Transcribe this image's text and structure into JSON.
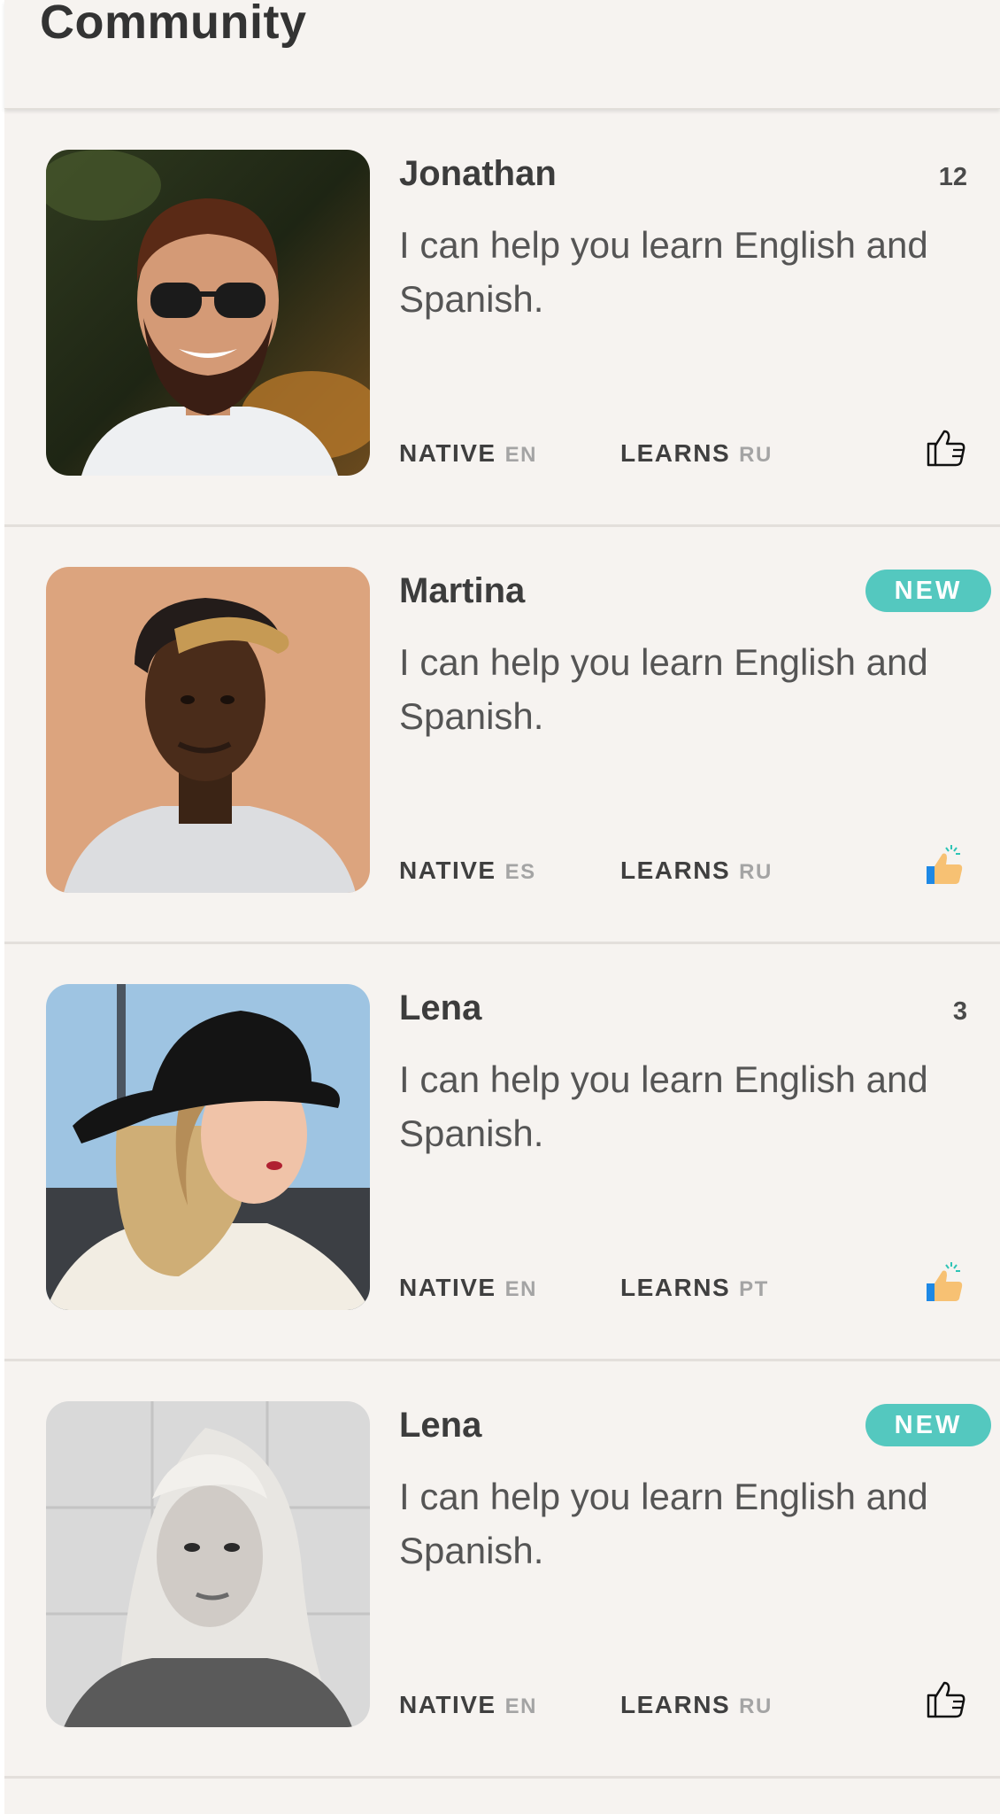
{
  "header": {
    "title": "Community"
  },
  "cards": [
    {
      "name": "Jonathan",
      "count": "12",
      "badge": "",
      "bio": "I can help you learn English and Spanish.",
      "native_label": "NATIVE",
      "native_code": "EN",
      "learns_label": "LEARNS",
      "learns_code": "RU",
      "like_icon": "thumbs-up-outline-icon"
    },
    {
      "name": "Martina",
      "count": "",
      "badge": "NEW",
      "bio": "I can help you learn English and Spanish.",
      "native_label": "NATIVE",
      "native_code": "ES",
      "learns_label": "LEARNS",
      "learns_code": "RU",
      "like_icon": "thumbs-up-colored-icon"
    },
    {
      "name": "Lena",
      "count": "3",
      "badge": "",
      "bio": "I can help you learn English and Spanish.",
      "native_label": "NATIVE",
      "native_code": "EN",
      "learns_label": "LEARNS",
      "learns_code": "PT",
      "like_icon": "thumbs-up-colored-icon"
    },
    {
      "name": "Lena",
      "count": "",
      "badge": "NEW",
      "bio": "I can help you learn English and Spanish.",
      "native_label": "NATIVE",
      "native_code": "EN",
      "learns_label": "LEARNS",
      "learns_code": "RU",
      "like_icon": "thumbs-up-outline-icon"
    }
  ],
  "colors": {
    "background": "#f6f3f0",
    "badge": "#54c8bf",
    "like_skin": "#f7c173",
    "like_sleeve": "#1e88e5",
    "text_dark": "#3c3c3c",
    "code_gray": "#a4a4a4"
  }
}
